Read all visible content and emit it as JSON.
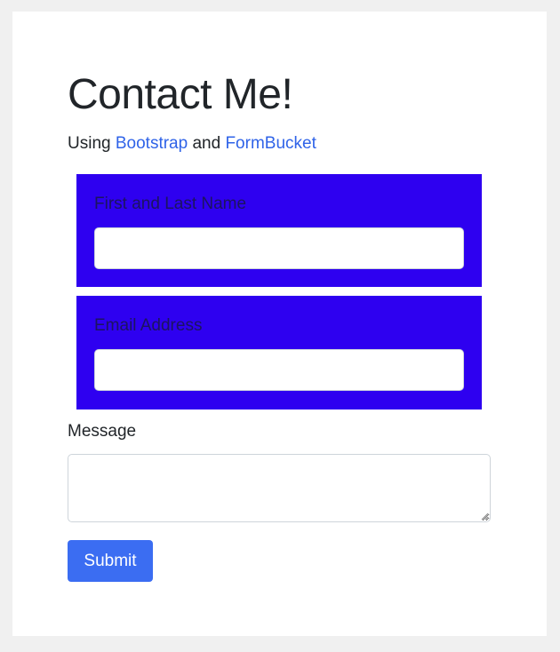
{
  "header": {
    "title": "Contact Me!",
    "subtitle_prefix": "Using ",
    "link_bootstrap": "Bootstrap",
    "subtitle_middle": " and ",
    "link_formbucket": "FormBucket"
  },
  "form": {
    "name_label": "First and Last Name",
    "name_value": "",
    "email_label": "Email Address",
    "email_value": "",
    "message_label": "Message",
    "message_value": "",
    "submit_label": "Submit"
  },
  "colors": {
    "page_background": "#f0f0f0",
    "card_background": "#ffffff",
    "field_highlight": "#2e00f0",
    "link": "#2f63e8",
    "button": "#3b6df2"
  }
}
